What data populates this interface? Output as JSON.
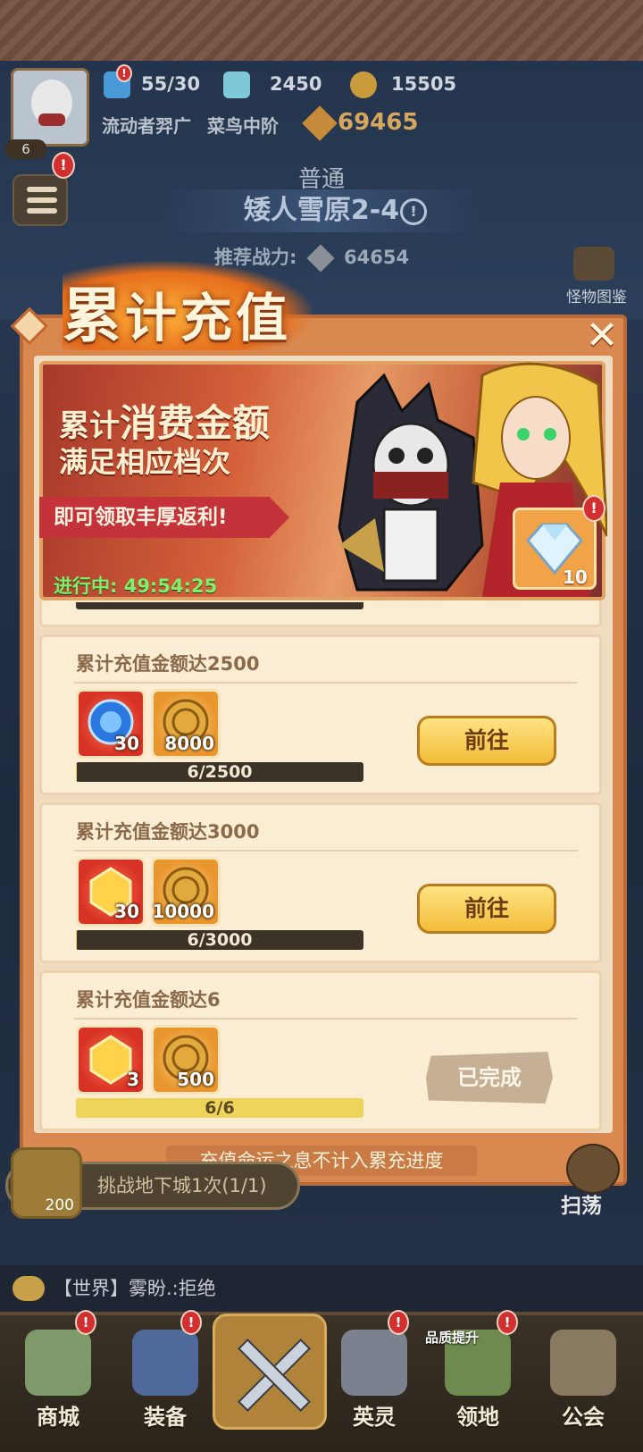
{
  "hud": {
    "level": "6",
    "energy": "55/30",
    "diamonds": "2450",
    "coins": "15505",
    "player_name": "流动者羿广",
    "player_rank": "菜鸟中阶",
    "player_power": "69465",
    "alert_mark": "!"
  },
  "stage": {
    "mode": "普通",
    "name": "矮人雪原2-4",
    "power_label": "推荐战力:",
    "power_value": "64654",
    "monster_book": "怪物图鉴"
  },
  "modal": {
    "title_big": "累",
    "title_rest": "计充值",
    "close": "✕",
    "banner": {
      "line1_a": "累计",
      "line1_b": "消费金额",
      "line2": "满足相应档次",
      "ribbon": "即可领取丰厚返利!",
      "timer": "进行中: 49:54:25",
      "gem_count": "10"
    },
    "tasks": [
      {
        "title": "累计充值金额达2500",
        "item1_count": "30",
        "item2_count": "8000",
        "progress_text": "6/2500",
        "progress": 0.0024,
        "action": "前往"
      },
      {
        "title": "累计充值金额达3000",
        "item1_count": "30",
        "item2_count": "10000",
        "progress_text": "6/3000",
        "progress": 0.002,
        "action": "前往"
      },
      {
        "title": "累计充值金额达6",
        "item1_count": "3",
        "item2_count": "500",
        "progress_text": "6/6",
        "progress": 1.0,
        "action": "已完成"
      }
    ],
    "footnote": "充值命运之息不计入累充进度"
  },
  "quest": {
    "coin_count": "200",
    "text": "挑战地下城1次(1/1)",
    "sweep": "扫荡"
  },
  "chat": {
    "text": "【世界】雾盼.:拒绝"
  },
  "nav": {
    "shop": "商城",
    "equip": "装备",
    "heroes": "英灵",
    "territory": "领地",
    "guild": "公会",
    "quality_up": "品质提升"
  },
  "colors": {
    "modal_bg": "#d9894f",
    "card_bg": "#fbecd4",
    "button_gold": "#f2bd38",
    "timer_green": "#7ef06a",
    "progress_fill": "#efd45a"
  }
}
